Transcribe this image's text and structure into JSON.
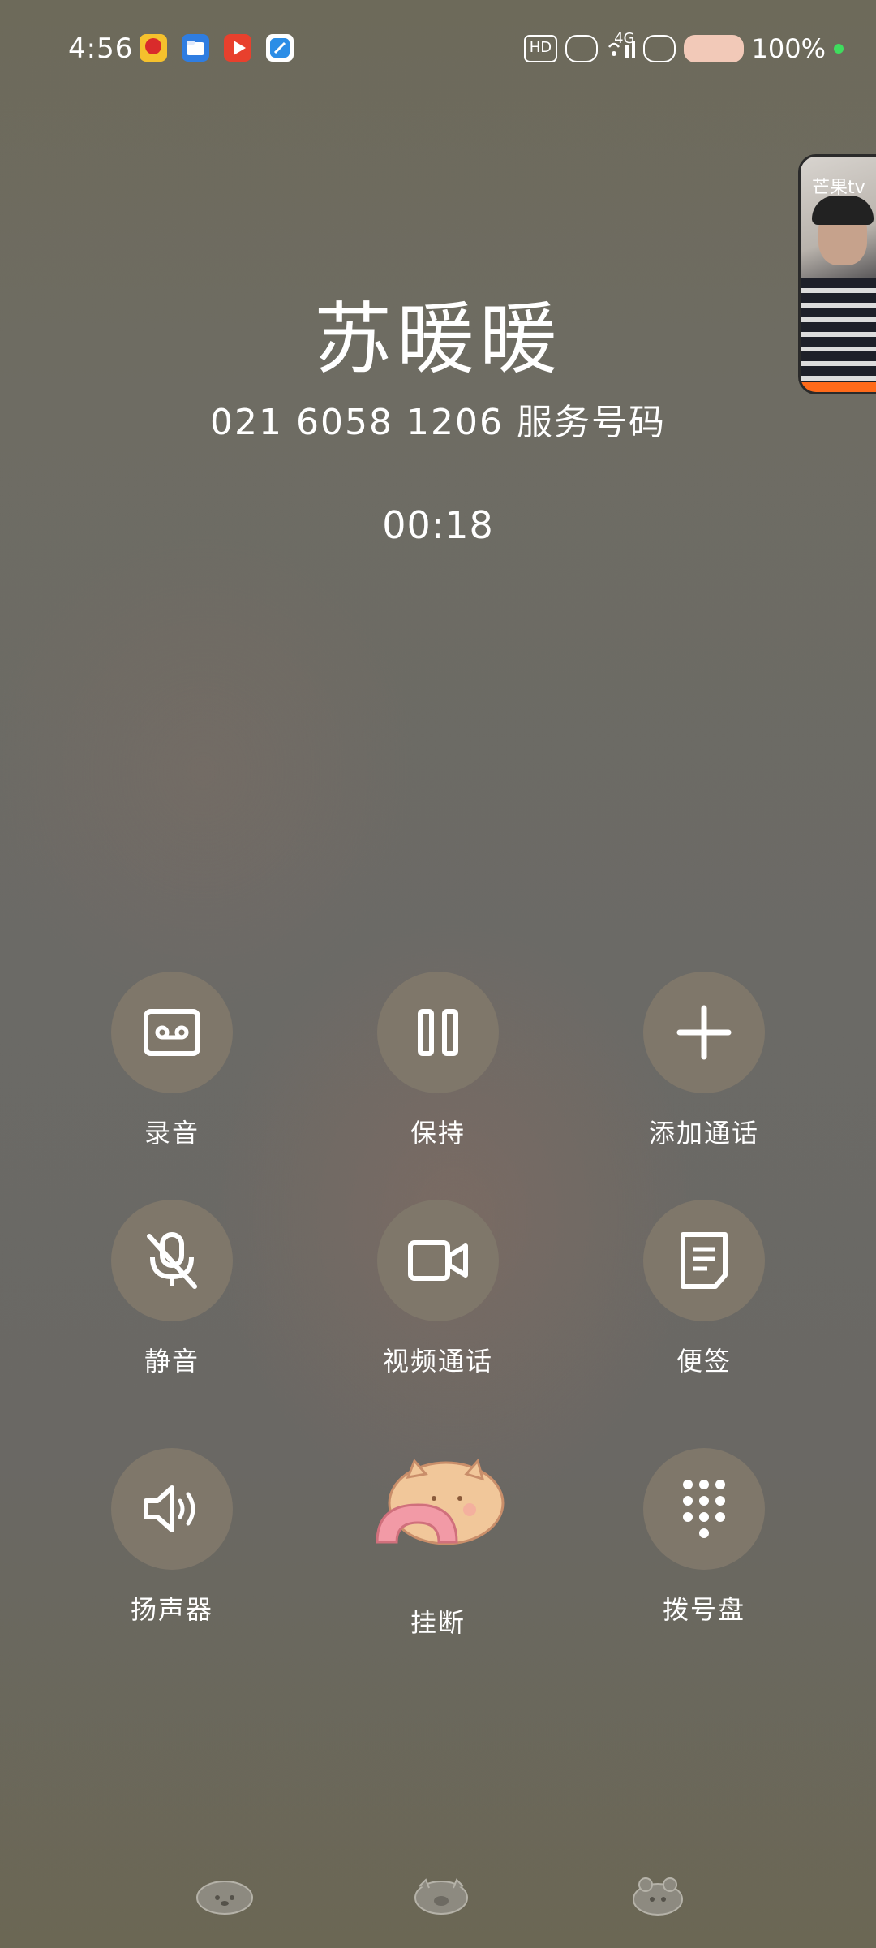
{
  "status_bar": {
    "time": "4:56",
    "network_badge": "HD",
    "network_type": "4G",
    "battery": "100%",
    "app_icons": [
      {
        "name": "flower-app-icon",
        "color": "#d92b2b"
      },
      {
        "name": "blue-folder-app-icon",
        "color": "#2f7de1"
      },
      {
        "name": "video-play-app-icon",
        "color": "#e8402d"
      },
      {
        "name": "browser-app-icon",
        "color": "#2b8de6"
      }
    ],
    "battery_dot_color": "#3fdc5e"
  },
  "pip": {
    "logo": "芒果tv"
  },
  "caller": {
    "name": "苏暖暖",
    "number": "021 6058 1206 服务号码",
    "duration": "00:18"
  },
  "actions": [
    {
      "id": "record",
      "label": "录音",
      "icon": "cassette-icon"
    },
    {
      "id": "hold",
      "label": "保持",
      "icon": "pause-icon"
    },
    {
      "id": "add-call",
      "label": "添加通话",
      "icon": "plus-icon"
    },
    {
      "id": "mute",
      "label": "静音",
      "icon": "mic-off-icon"
    },
    {
      "id": "video-call",
      "label": "视频通话",
      "icon": "video-camera-icon"
    },
    {
      "id": "notes",
      "label": "便签",
      "icon": "note-icon"
    },
    {
      "id": "speaker",
      "label": "扬声器",
      "icon": "speaker-icon"
    },
    {
      "id": "hangup",
      "label": "挂断",
      "icon": "hangup-cat-icon"
    },
    {
      "id": "dialpad",
      "label": "拨号盘",
      "icon": "dialpad-icon"
    }
  ],
  "nav_bar": [
    "back-key-icon",
    "home-key-icon",
    "recents-key-icon"
  ]
}
